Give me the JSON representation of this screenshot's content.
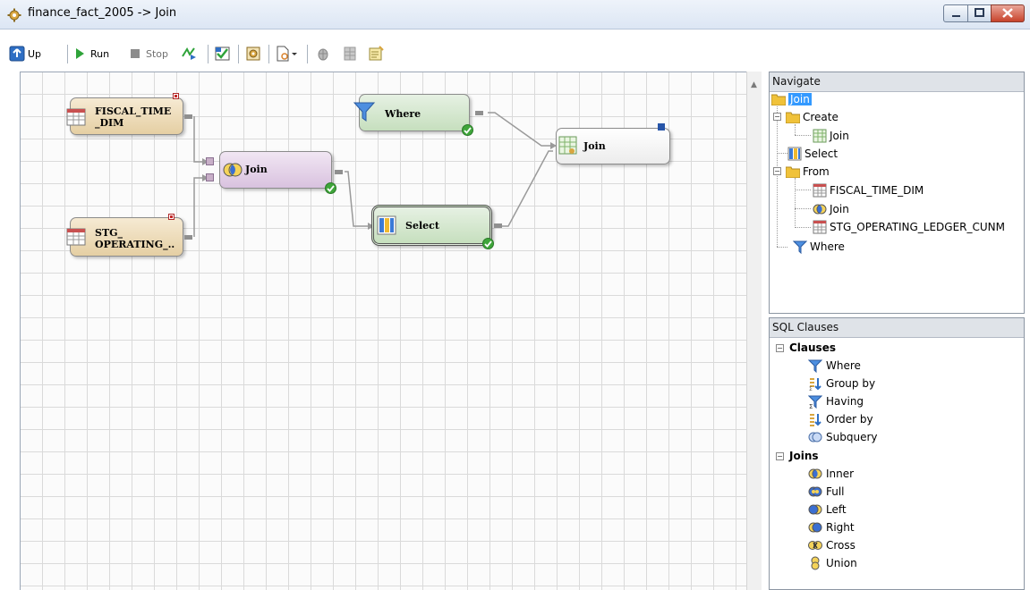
{
  "window": {
    "title": "finance_fact_2005 -> Join"
  },
  "toolbar": {
    "up_label": "Up",
    "run_label": "Run",
    "stop_label": "Stop"
  },
  "canvas": {
    "nodes": {
      "fiscal_time_dim": "FISCAL_TIME\n_DIM",
      "stg_operating": "STG_\nOPERATING_..",
      "join_mid": "Join",
      "where": "Where",
      "select": "Select",
      "join_target": "Join"
    }
  },
  "navigate": {
    "header": "Navigate",
    "root": "Join",
    "create": "Create",
    "create_join": "Join",
    "select": "Select",
    "from": "From",
    "from_fiscal": "FISCAL_TIME_DIM",
    "from_join": "Join",
    "from_stg": "STG_OPERATING_LEDGER_CUNM",
    "where": "Where"
  },
  "sql_clauses": {
    "header": "SQL Clauses",
    "clauses_title": "Clauses",
    "clauses": [
      "Where",
      "Group by",
      "Having",
      "Order by",
      "Subquery"
    ],
    "joins_title": "Joins",
    "joins": [
      "Inner",
      "Full",
      "Left",
      "Right",
      "Cross",
      "Union"
    ]
  },
  "colors": {
    "selection": "#3399ff",
    "table_node": "#e5cfa3",
    "join_node": "#d9c2df",
    "green_node": "#c6dfbe",
    "check": "#3fa53a",
    "folder": "#f0c23a"
  }
}
